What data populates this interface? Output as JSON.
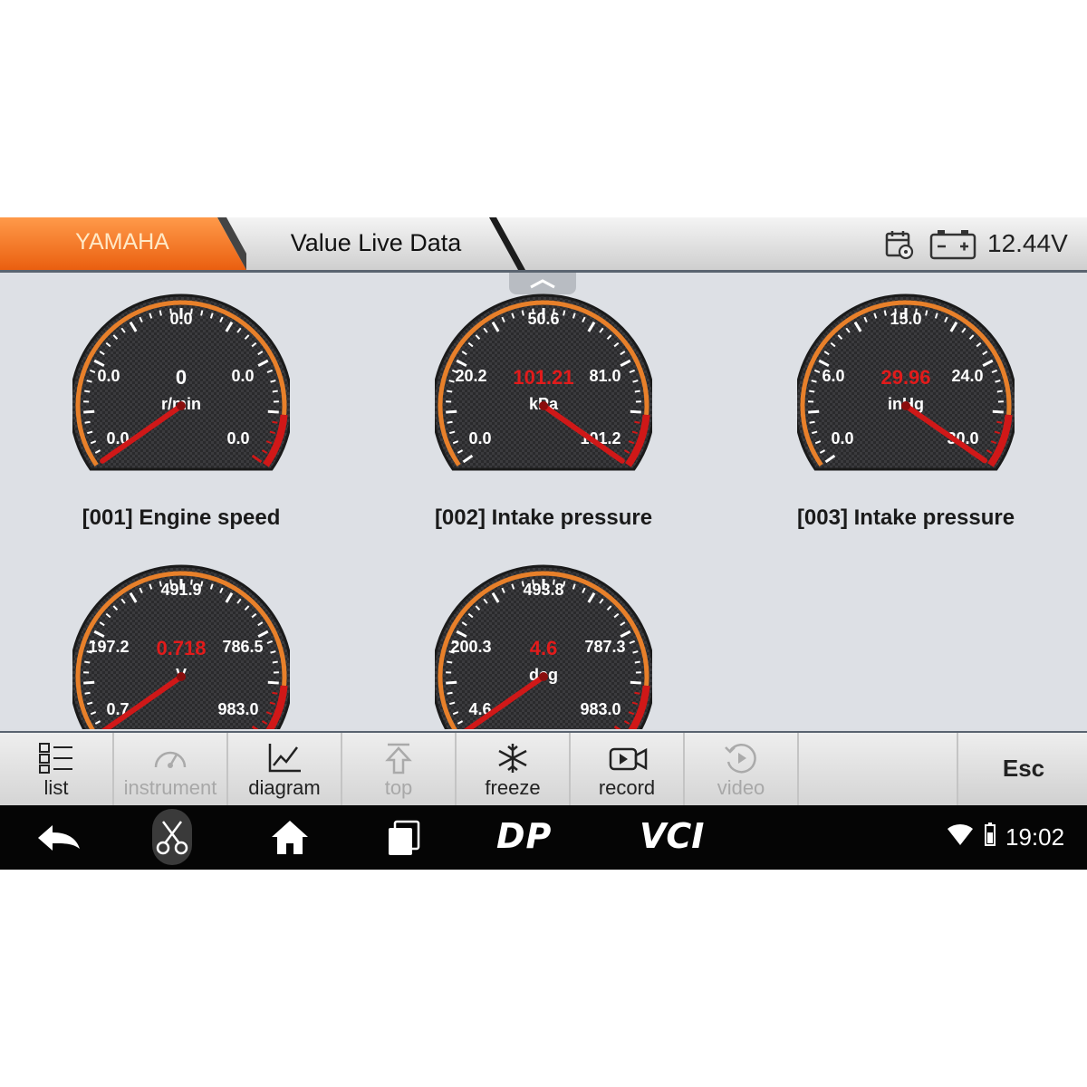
{
  "header": {
    "brand": "YAMAHA",
    "title": "Value Live Data",
    "battery_voltage": "12.44V",
    "icons": [
      "calendar-settings-icon",
      "battery-icon"
    ]
  },
  "gauges": [
    {
      "label": "[001] Engine speed",
      "value": "0",
      "unit": "r/min",
      "scale": [
        "0.0",
        "0.0",
        "0.0",
        "0.0",
        "0.0"
      ],
      "needle_fraction": 0.0
    },
    {
      "label": "[002] Intake pressure",
      "value": "101.21",
      "unit": "kPa",
      "scale": [
        "0.0",
        "20.2",
        "50.6",
        "81.0",
        "101.2"
      ],
      "needle_fraction": 1.0
    },
    {
      "label": "[003] Intake pressure",
      "value": "29.96",
      "unit": "inHg",
      "scale": [
        "0.0",
        "6.0",
        "15.0",
        "24.0",
        "30.0"
      ],
      "needle_fraction": 0.999
    },
    {
      "label": "",
      "value": "0.718",
      "unit": "V",
      "scale": [
        "0.7",
        "197.2",
        "491.9",
        "786.5",
        "983.0"
      ],
      "needle_fraction": 0.0
    },
    {
      "label": "",
      "value": "4.6",
      "unit": "deg",
      "scale": [
        "4.6",
        "200.3",
        "493.8",
        "787.3",
        "983.0"
      ],
      "needle_fraction": 0.0
    }
  ],
  "toolbar": {
    "buttons": [
      {
        "label": "list",
        "icon": "list-icon",
        "enabled": true
      },
      {
        "label": "instrument",
        "icon": "gauge-icon",
        "enabled": false
      },
      {
        "label": "diagram",
        "icon": "line-chart-icon",
        "enabled": true
      },
      {
        "label": "top",
        "icon": "arrow-up-icon",
        "enabled": false
      },
      {
        "label": "freeze",
        "icon": "snowflake-icon",
        "enabled": true
      },
      {
        "label": "record",
        "icon": "video-camera-icon",
        "enabled": true
      },
      {
        "label": "video",
        "icon": "replay-icon",
        "enabled": false
      }
    ],
    "esc_label": "Esc"
  },
  "navbar": {
    "dp_label": "DP",
    "vci_label": "VCI",
    "time": "19:02",
    "icons": [
      "back-icon",
      "scissors-icon",
      "home-icon",
      "recent-apps-icon",
      "wifi-icon",
      "battery-status-icon"
    ]
  },
  "colors": {
    "brand_orange": "#f0731e",
    "gauge_orange": "#e8802a",
    "gauge_red": "#d01818",
    "value_red": "#e21b1b"
  }
}
